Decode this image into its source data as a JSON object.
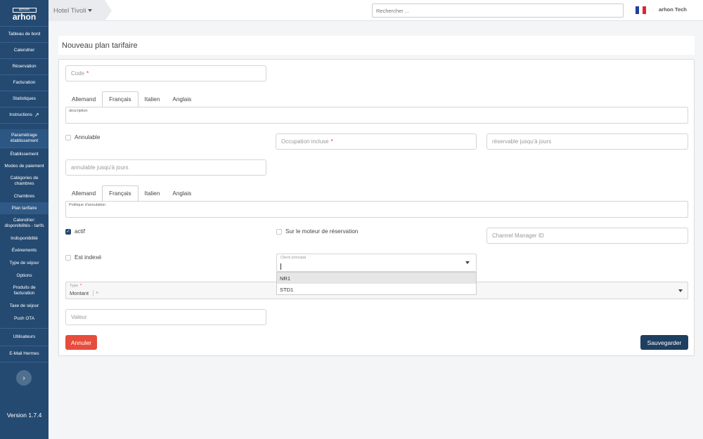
{
  "sidebar": {
    "logo_top": "arhon",
    "logo_name": "arhon",
    "items": [
      {
        "label": "Tableau de bord"
      },
      {
        "label": "Calendrier"
      },
      {
        "label": "Réservation"
      },
      {
        "label": "Facturation"
      },
      {
        "label": "Statistiques"
      },
      {
        "label": "Instructions"
      },
      {
        "label": "Paramétrage établissement"
      },
      {
        "label": "Établissement"
      },
      {
        "label": "Modes de paiement"
      },
      {
        "label": "Catégories de chambres"
      },
      {
        "label": "Chambres"
      },
      {
        "label": "Plan tarifaire"
      },
      {
        "label": "Calendrier: disponibilités - tarifs"
      },
      {
        "label": "Indisponibilité"
      },
      {
        "label": "Événements"
      },
      {
        "label": "Type de séjour"
      },
      {
        "label": "Options"
      },
      {
        "label": "Produits de facturation"
      },
      {
        "label": "Taxe de séjour"
      },
      {
        "label": "Push OTA"
      },
      {
        "label": "Utilisateurs"
      },
      {
        "label": "E-Mail Hermes"
      }
    ],
    "version": "Version 1.7.4"
  },
  "topbar": {
    "hotel": "Hotel Tivoli",
    "search_placeholder": "Rechercher ...",
    "user": "arhon Tech"
  },
  "page": {
    "title": "Nouveau plan tarifaire"
  },
  "form": {
    "code_placeholder": "Code",
    "tabs1": [
      "Allemand",
      "Français",
      "Italien",
      "Anglais"
    ],
    "description_label": "description",
    "annulable_label": "Annulable",
    "occupation_placeholder": "Occupation incluse",
    "reservable_placeholder": "réservable jusqu'à jours",
    "annulable_jours_placeholder": "annulable jusqu'à jours",
    "tabs2": [
      "Allemand",
      "Français",
      "Italien",
      "Anglais"
    ],
    "politique_label": "Politique d'annulation",
    "actif_label": "actif",
    "moteur_label": "Sur le moteur de réservation",
    "channel_placeholder": "Channel Manager ID",
    "indexe_label": "Est indexé",
    "client_label": "Client principal",
    "client_options": [
      "NR1",
      "STD1"
    ],
    "type_label": "Type",
    "type_value": "Montant",
    "type_clear": "×",
    "valeur_placeholder": "Valeur",
    "cancel_label": "Annuler",
    "save_label": "Sauvegarder"
  },
  "colors": {
    "sidebar": "#244a72",
    "cancel": "#e74c3c",
    "save": "#1f3f61"
  }
}
